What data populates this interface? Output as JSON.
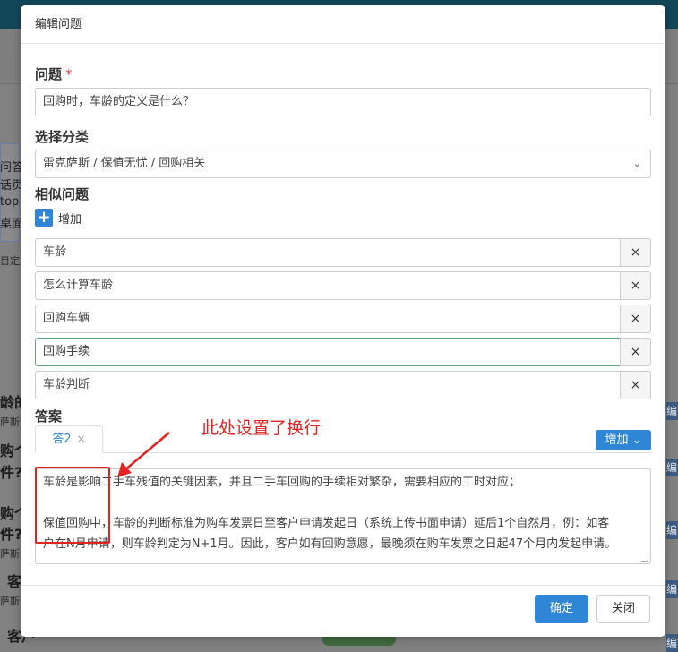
{
  "background": {
    "fragments": [
      {
        "id": "f1",
        "text": "问答"
      },
      {
        "id": "f2",
        "text": "话页"
      },
      {
        "id": "f3",
        "text": "top"
      },
      {
        "id": "f4",
        "text": "桌面"
      },
      {
        "id": "f5",
        "text": "目定义"
      },
      {
        "id": "f6",
        "text": "龄的"
      },
      {
        "id": "f7",
        "text": "萨斯 /"
      },
      {
        "id": "f8",
        "text": "购个"
      },
      {
        "id": "f9",
        "text": "件?"
      },
      {
        "id": "f10",
        "text": "购个"
      },
      {
        "id": "f11",
        "text": "萨斯 /"
      },
      {
        "id": "f12",
        "text": "件?"
      },
      {
        "id": "f13",
        "text": "客"
      },
      {
        "id": "f14",
        "text": "萨斯 /"
      },
      {
        "id": "f15",
        "text": "客户"
      }
    ],
    "edit_label": "编辑"
  },
  "modal": {
    "title": "编辑问题",
    "question": {
      "label": "问题",
      "required_mark": "*",
      "value": "回购时，车龄的定义是什么？"
    },
    "category": {
      "label": "选择分类",
      "value": "雷克萨斯 / 保值无忧 / 回购相关"
    },
    "similar": {
      "label": "相似问题",
      "add_label": "增加",
      "delete_symbol": "×",
      "items": [
        "车龄",
        "怎么计算车龄",
        "回购车辆",
        "回购手续",
        "车龄判断"
      ]
    },
    "answer": {
      "label": "答案",
      "tab_label": "答2",
      "tab_close": "×",
      "add_button": "增加",
      "line1": "车龄是影响二手车残值的关键因素，并且二手车回购的手续相对繁杂，需要相应的工时对应；",
      "line2": "保值回购中，车龄的判断标准为购车发票日至客户申请发起日（系统上传书面申请）延后1个自然月，例：如客",
      "line3": "户在N月申请，则车龄判定为N+1月。因此，客户如有回购意愿，最晚须在购车发票之日起47个月内发起申请。"
    },
    "annotation": "此处设置了换行",
    "confirm": "确定",
    "close": "关闭"
  },
  "colors": {
    "primary": "#2f86d6",
    "annotation": "#e52222",
    "required": "#ee3333"
  }
}
